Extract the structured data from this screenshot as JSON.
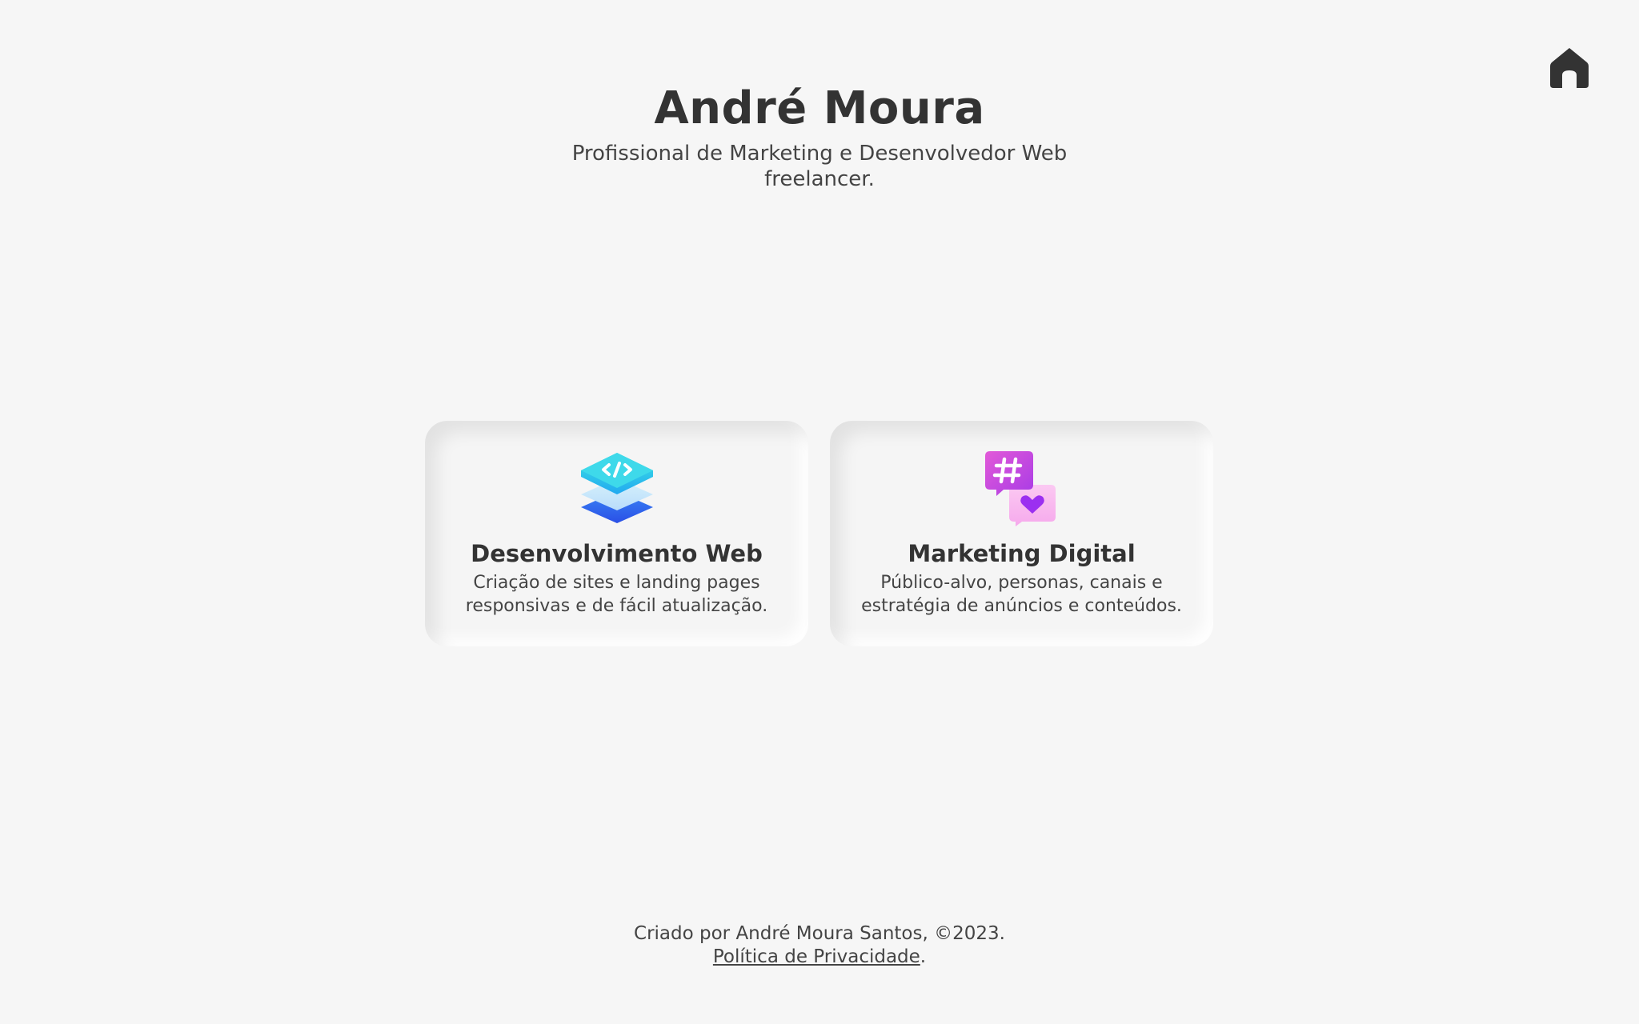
{
  "header": {
    "title": "André Moura",
    "subtitle": "Profissional de Marketing e Desenvolvedor Web freelancer."
  },
  "nav": {
    "home_icon": "home-icon"
  },
  "cards": [
    {
      "icon": "code-layers-icon",
      "title": "Desenvolvimento Web",
      "description": "Criação de sites e landing pages responsivas e de fácil atualização."
    },
    {
      "icon": "hashtag-heart-chat-icon",
      "title": "Marketing Digital",
      "description": "Público-alvo, personas, canais e estratégia de anúncios e conteúdos."
    }
  ],
  "footer": {
    "credit": "Criado por André Moura Santos, ©2023.",
    "privacy_link": "Política de Privacidade",
    "trailing": "."
  },
  "colors": {
    "background": "#f6f6f6",
    "text": "#333333",
    "web_icon_top": "#38d6e8",
    "web_icon_bottom": "#2f63f0",
    "mkt_icon_primary": "#c23fe0",
    "mkt_icon_secondary": "#f7b8ee",
    "mkt_heart": "#9b2ff0"
  }
}
